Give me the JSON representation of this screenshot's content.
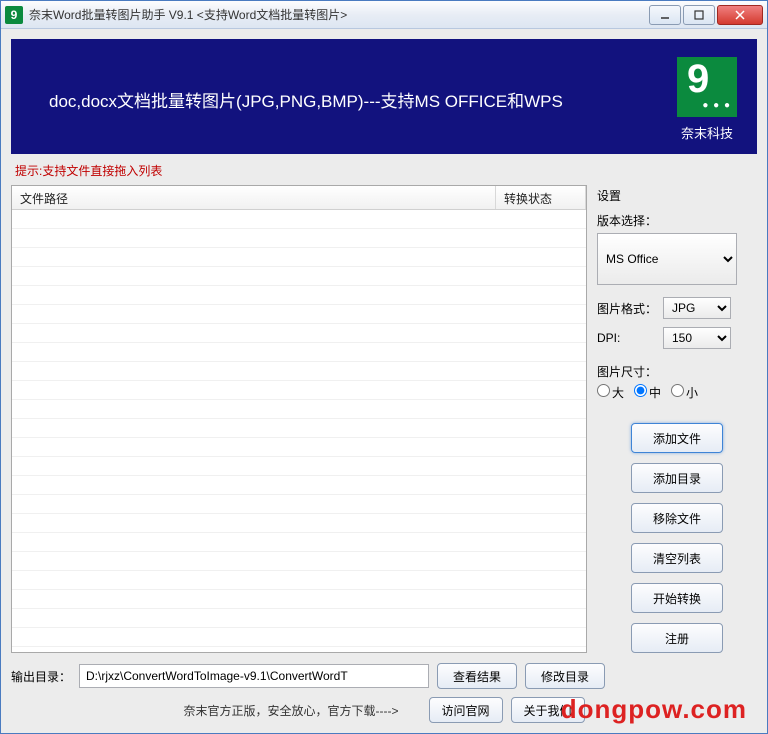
{
  "titlebar": {
    "title": "奈末Word批量转图片助手  V9.1  <支持Word文档批量转图片>"
  },
  "banner": {
    "text": "doc,docx文档批量转图片(JPG,PNG,BMP)---支持MS OFFICE和WPS",
    "logo_label": "奈末科技"
  },
  "hint": "提示:支持文件直接拖入列表",
  "table": {
    "col_path": "文件路径",
    "col_status": "转换状态"
  },
  "settings": {
    "section_title": "设置",
    "version_label": "版本选择：",
    "version_value": "MS Office",
    "format_label": "图片格式：",
    "format_value": "JPG",
    "dpi_label": "DPI:",
    "dpi_value": "150",
    "size_label": "图片尺寸：",
    "size_options": {
      "large": "大",
      "medium": "中",
      "small": "小"
    }
  },
  "buttons": {
    "add_file": "添加文件",
    "add_dir": "添加目录",
    "remove_file": "移除文件",
    "clear_list": "清空列表",
    "start": "开始转换",
    "register": "注册"
  },
  "output": {
    "label": "输出目录：",
    "path": "D:\\rjxz\\ConvertWordToImage-v9.1\\ConvertWordT",
    "view_result": "查看结果",
    "change_dir": "修改目录"
  },
  "footer": {
    "text": "奈末官方正版，安全放心，官方下载---->",
    "visit": "访问官网",
    "about": "关于我们"
  },
  "watermark": "dongpow.com"
}
